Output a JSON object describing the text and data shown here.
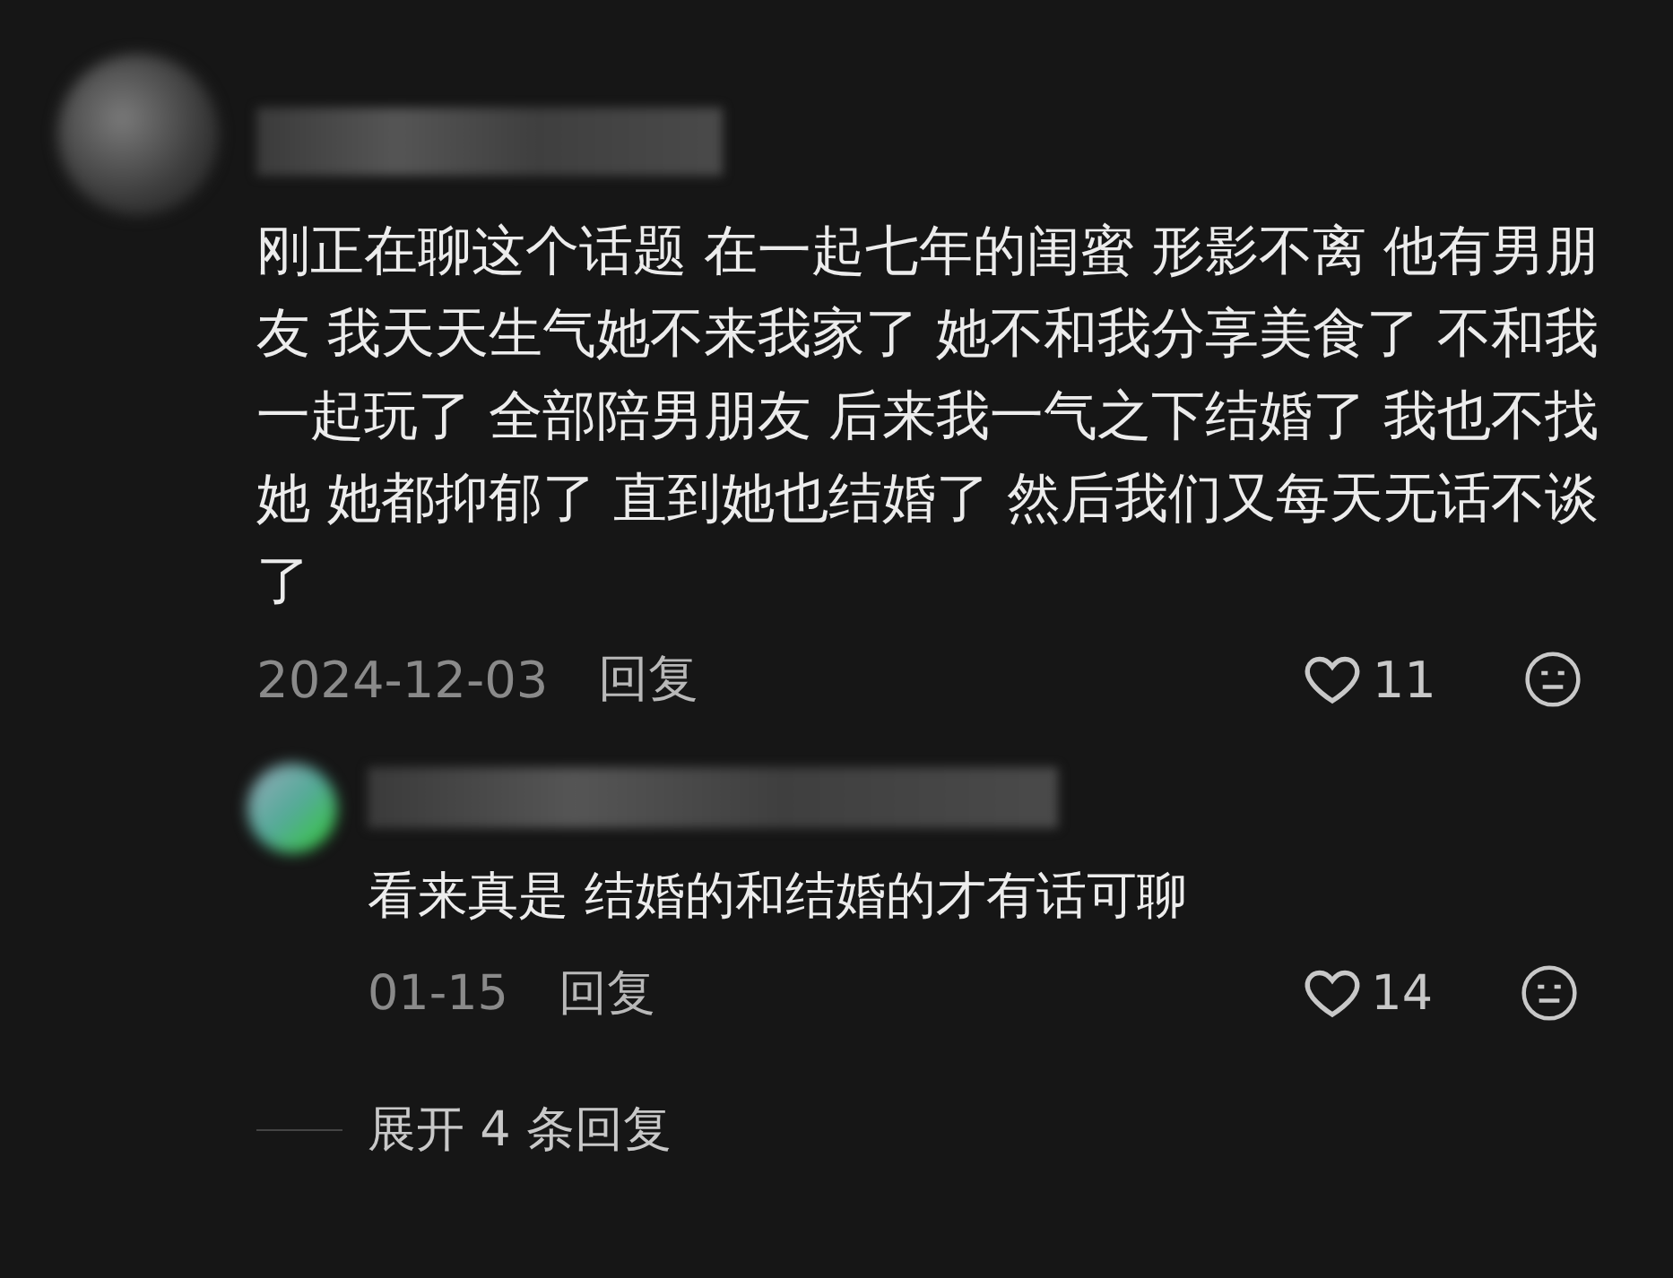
{
  "comment": {
    "text": "刚正在聊这个话题 在一起七年的闺蜜 形影不离 他有男朋友 我天天生气她不来我家了 她不和我分享美食了 不和我一起玩了 全部陪男朋友 后来我一气之下结婚了 我也不找她 她都抑郁了 直到她也结婚了 然后我们又每天无话不谈了",
    "date": "2024-12-03",
    "reply_label": "回复",
    "likes": "11",
    "replies": [
      {
        "text": "看来真是 结婚的和结婚的才有话可聊",
        "date": "01-15",
        "reply_label": "回复",
        "likes": "14"
      }
    ],
    "expand": "展开 4 条回复"
  }
}
